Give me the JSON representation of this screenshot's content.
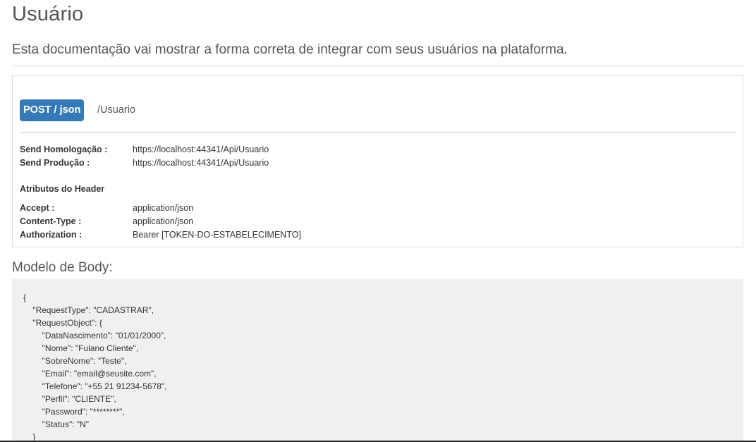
{
  "page": {
    "title": "Usuário",
    "subtitle": "Esta documentação vai mostrar a forma correta de integrar com seus usuários na plataforma."
  },
  "endpoint": {
    "method_label": "POST / json",
    "path": "/Usuario",
    "method_color": "#337ab7",
    "urls": [
      {
        "key": "Send Homologação :",
        "value": "https://localhost:44341/Api/Usuario"
      },
      {
        "key": "Send Produção :",
        "value": "https://localhost:44341/Api/Usuario"
      }
    ],
    "headers_title": "Atributos do Header",
    "headers": [
      {
        "key": "Accept :",
        "value": "application/json"
      },
      {
        "key": "Content-Type :",
        "value": "application/json"
      },
      {
        "key": "Authorization :",
        "value": "Bearer [TOKEN-DO-ESTABELECIMENTO]"
      }
    ]
  },
  "body_model": {
    "title": "Modelo de Body:",
    "code": "{\n    \"RequestType\": \"CADASTRAR\",\n    \"RequestObject\": {\n        \"DataNascimento\": \"01/01/2000\",\n        \"Nome\": \"Fulano Cliente\",\n        \"SobreNome\": \"Teste\",\n        \"Email\": \"email@seusite.com\",\n        \"Telefone\": \"+55 21 91234-5678\",\n        \"Perfil\": \"CLIENTE\",\n        \"Password\": \"********\",\n        \"Status\": \"N\"\n    }\n}"
  }
}
